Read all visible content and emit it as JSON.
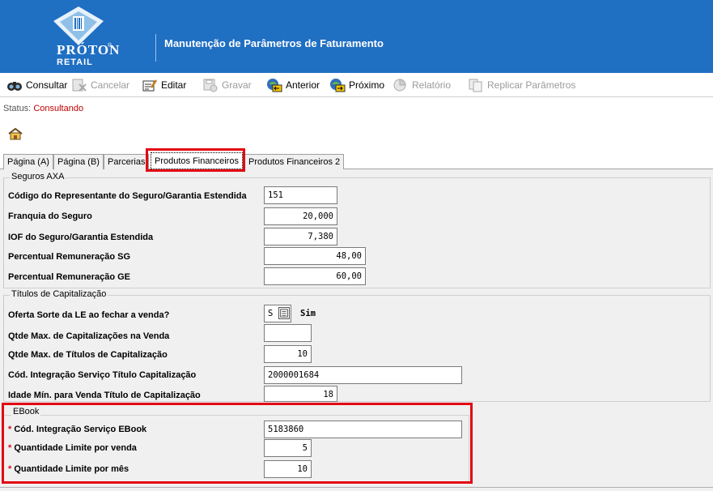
{
  "header": {
    "logo_text_top": "PRÓTON",
    "logo_text_bottom": "RETAIL",
    "logo_reg": "®",
    "title": "Manutenção de Parâmetros de Faturamento"
  },
  "toolbar": {
    "consultar": "Consultar",
    "cancelar": "Cancelar",
    "editar": "Editar",
    "gravar": "Gravar",
    "anterior": "Anterior",
    "proximo": "Próximo",
    "relatorio": "Relatório",
    "replicar": "Replicar Parâmetros"
  },
  "status": {
    "label": "Status:",
    "value": "Consultando"
  },
  "tabs": [
    "Página (A)",
    "Página (B)",
    "Parcerias",
    "Produtos Financeiros",
    "Produtos Financeiros 2"
  ],
  "seguros": {
    "title": "Seguros AXA",
    "cod_rep_label": "Código do Representante do Seguro/Garantia Estendida",
    "cod_rep_value": "151",
    "franquia_label": "Franquia do Seguro",
    "franquia_value": "20,000",
    "iof_label": "IOF do Seguro/Garantia Estendida",
    "iof_value": "7,380",
    "perc_sg_label": "Percentual Remuneração SG",
    "perc_sg_value": "48,00",
    "perc_ge_label": "Percentual Remuneração GE",
    "perc_ge_value": "60,00"
  },
  "titulos": {
    "title": "Títulos de Capitalização",
    "oferta_label": "Oferta Sorte da LE ao fechar a venda?",
    "oferta_code": "S",
    "oferta_desc": "Sim",
    "qtde_cap_label": "Qtde Max. de  Capitalizações na Venda",
    "qtde_cap_value": "",
    "qtde_tit_label": "Qtde Max. de Títulos de Capitalização",
    "qtde_tit_value": "10",
    "cod_int_label": "Cód. Integração Serviço Título Capitalização",
    "cod_int_value": "2000001684",
    "idade_label": "Idade Mín. para Venda Título de Capitalização",
    "idade_value": "18"
  },
  "ebook": {
    "title": "EBook",
    "cod_label": "Cód. Integração Serviço EBook",
    "cod_value": "5183860",
    "qtd_venda_label": "Quantidade Limite por venda",
    "qtd_venda_value": "5",
    "qtd_mes_label": "Quantidade Limite por mês",
    "qtd_mes_value": "10",
    "required_mark": "*"
  },
  "colors": {
    "header_bg": "#1f6fc3",
    "highlight": "#e30613",
    "status_value": "#c00000"
  }
}
